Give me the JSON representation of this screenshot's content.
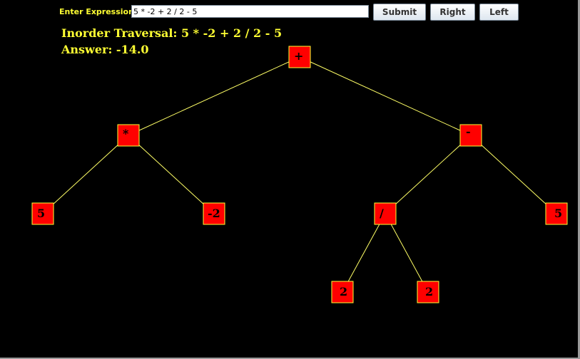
{
  "toolbar": {
    "expression_label": "Enter Expression",
    "expression_value": "5 * -2 + 2 / 2 - 5",
    "submit_label": "Submit",
    "right_label": "Right",
    "left_label": "Left"
  },
  "result": {
    "traversal_label": "Inorder Traversal:",
    "traversal_value": "5 * -2 + 2 / 2 - 5",
    "answer_label": "Answer:",
    "answer_value": "-14.0"
  },
  "tree": {
    "nodes": [
      {
        "id": "n1",
        "label": "+"
      },
      {
        "id": "n2",
        "label": "*"
      },
      {
        "id": "n3",
        "label": "-"
      },
      {
        "id": "n4",
        "label": "5"
      },
      {
        "id": "n5",
        "label": "-2"
      },
      {
        "id": "n6",
        "label": "/"
      },
      {
        "id": "n7",
        "label": "5"
      },
      {
        "id": "n8",
        "label": "2"
      },
      {
        "id": "n9",
        "label": "2"
      }
    ],
    "edges": [
      [
        "n1",
        "n2"
      ],
      [
        "n1",
        "n3"
      ],
      [
        "n2",
        "n4"
      ],
      [
        "n2",
        "n5"
      ],
      [
        "n3",
        "n6"
      ],
      [
        "n3",
        "n7"
      ],
      [
        "n6",
        "n8"
      ],
      [
        "n6",
        "n9"
      ]
    ]
  },
  "colors": {
    "background": "#000000",
    "node_fill": "#ff0000",
    "node_border": "#ffff33",
    "edge": "#ffff66",
    "text_accent": "#ffff33"
  }
}
